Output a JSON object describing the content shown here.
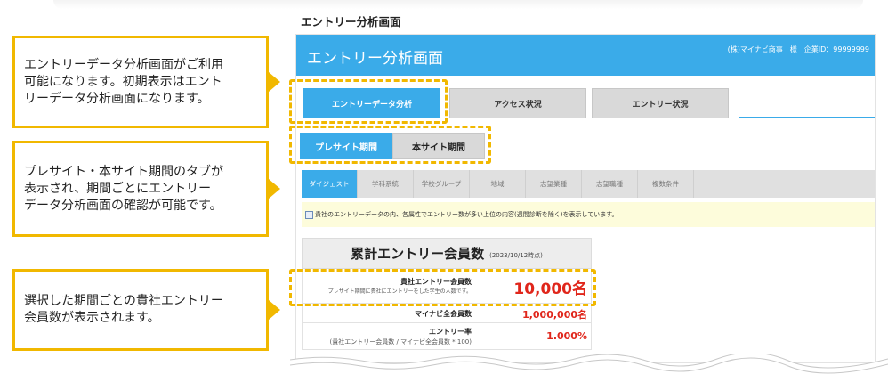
{
  "section_title": "エントリー分析画面",
  "callouts": [
    {
      "lines": [
        "エントリーデータ分析画面がご利用",
        "可能になります。初期表示はエント",
        "リーデータ分析画面になります。"
      ]
    },
    {
      "lines": [
        "プレサイト・本サイト期間のタブが",
        "表示され、期間ごとにエントリー",
        "データ分析画面の確認が可能です。"
      ]
    },
    {
      "lines": [
        "選択した期間ごとの貴社エントリー",
        "会員数が表示されます。"
      ]
    }
  ],
  "app": {
    "title": "エントリー分析画面",
    "company": "(株)マイナビ商事　様　企業ID：99999999"
  },
  "main_tabs": [
    {
      "label": "エントリーデータ分析",
      "active": true
    },
    {
      "label": "アクセス状況",
      "active": false
    },
    {
      "label": "エントリー状況",
      "active": false
    }
  ],
  "period_tabs": [
    {
      "label": "プレサイト期間",
      "active": true
    },
    {
      "label": "本サイト期間",
      "active": false
    }
  ],
  "sub_tabs": [
    {
      "label": "ダイジェスト",
      "active": true
    },
    {
      "label": "学科系統",
      "active": false
    },
    {
      "label": "学校グループ",
      "active": false
    },
    {
      "label": "地域",
      "active": false
    },
    {
      "label": "志望業種",
      "active": false
    },
    {
      "label": "志望職種",
      "active": false
    },
    {
      "label": "複数条件",
      "active": false
    }
  ],
  "notice": "貴社のエントリーデータの内、各属性でエントリー数が多い上位の内容(週間診断を除く)を表示しています。",
  "stats": {
    "title": "累計エントリー会員数",
    "date": "(2023/10/12時点)",
    "rows": [
      {
        "label": "貴社エントリー会員数",
        "sub": "プレサイト期間に貴社にエントリーをした学生の人数です。",
        "value": "10,000名"
      },
      {
        "label": "マイナビ全会員数",
        "sub": "",
        "value": "1,000,000名"
      },
      {
        "label": "エントリー率",
        "sub": "(貴社エントリー会員数 / マイナビ全会員数 * 100)",
        "value": "1.000%"
      }
    ]
  },
  "colors": {
    "accent": "#3aabe9",
    "highlight": "#f1b800",
    "value_red": "#e0261b"
  }
}
